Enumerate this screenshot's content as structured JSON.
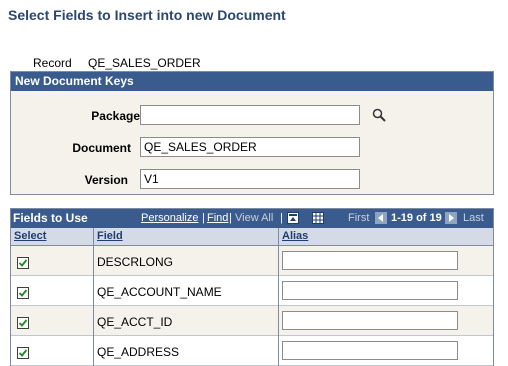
{
  "page": {
    "title": "Select Fields to Insert into new Document",
    "record_label": "Record",
    "record_value": "QE_SALES_ORDER"
  },
  "keys": {
    "header": "New Document Keys",
    "package_label": "Package",
    "package_value": "",
    "document_label": "Document",
    "document_value": "QE_SALES_ORDER",
    "version_label": "Version",
    "version_value": "V1"
  },
  "grid": {
    "title": "Fields to Use",
    "personalize": "Personalize",
    "sep1": "|",
    "find": "Find",
    "sep2": "|",
    "view_all": "View All",
    "sep3": "|",
    "first": "First",
    "range": "1-19 of 19",
    "last": "Last",
    "columns": {
      "select": "Select",
      "field": "Field",
      "alias": "Alias"
    },
    "rows": [
      {
        "checked": true,
        "field": "DESCRLONG",
        "alias": ""
      },
      {
        "checked": true,
        "field": "QE_ACCOUNT_NAME",
        "alias": ""
      },
      {
        "checked": true,
        "field": "QE_ACCT_ID",
        "alias": ""
      },
      {
        "checked": true,
        "field": "QE_ADDRESS",
        "alias": ""
      }
    ]
  },
  "icons": {
    "lookup": "magnifier-icon",
    "zoom": "zoom-grid-icon",
    "download": "download-grid-icon",
    "prev": "previous-arrow-icon",
    "next": "next-arrow-icon"
  },
  "colors": {
    "header_bg": "#3a5b8e",
    "title": "#2b4770",
    "panel_bg": "#f4f2ea"
  }
}
